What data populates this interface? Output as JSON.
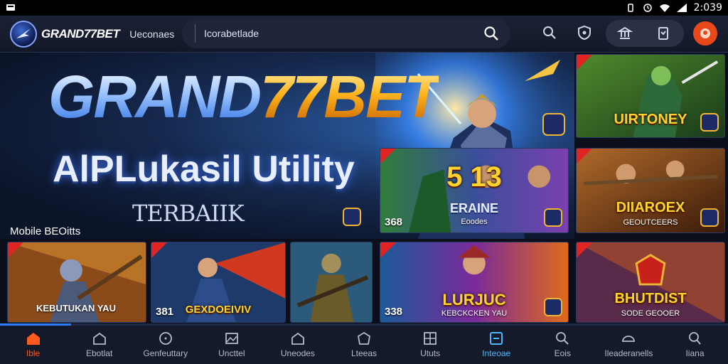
{
  "status_bar": {
    "time": "2:039"
  },
  "header": {
    "logo_text": "GRAND77BET",
    "nav_link": "Ueconaes",
    "search_text": "Icorabetlade"
  },
  "hero": {
    "brand_part_1": "GRAND",
    "brand_part_2": "77BET",
    "tagline": "AlPLukasil Utility",
    "subtagline": "TERBAIIK"
  },
  "section": {
    "label": "Mobile BEOitts"
  },
  "tiles": {
    "t1": {
      "title": "UIRTONEY"
    },
    "t2": {
      "title": "5 13",
      "subtitle": "ERAINE",
      "sub2": "Eoodes",
      "number": "368"
    },
    "t3": {
      "title": "DIIAROEX",
      "subtitle": "GEOUTCEERS"
    },
    "t4": {
      "caption": "KEBUTUKAN YAU"
    },
    "t5": {
      "title": "GEXDOEIVIV",
      "number": "381"
    },
    "t6": {},
    "t7": {
      "title": "LURJUC",
      "subtitle": "KEBCKCKEN YAU",
      "number": "338"
    },
    "t8": {
      "title": "BHUTDIST",
      "subtitle": "SODE GEOOER"
    }
  },
  "bottom_nav": [
    {
      "label": "Ible",
      "icon": "home-icon"
    },
    {
      "label": "Ebotlat",
      "icon": "home-outline-icon"
    },
    {
      "label": "Genfeuttary",
      "icon": "clock-icon"
    },
    {
      "label": "Uncttel",
      "icon": "image-icon"
    },
    {
      "label": "Uneodes",
      "icon": "house-icon"
    },
    {
      "label": "Lteeas",
      "icon": "store-icon"
    },
    {
      "label": "Ututs",
      "icon": "grid-icon"
    },
    {
      "label": "Inteoae",
      "icon": "square-icon"
    },
    {
      "label": "Eois",
      "icon": "search-icon"
    },
    {
      "label": "Ileaderanells",
      "icon": "chat-icon"
    },
    {
      "label": "Iiana",
      "icon": "magnify-icon"
    }
  ],
  "colors": {
    "accent_active": "#ff5a1f",
    "accent_selected": "#4db6ff",
    "avatar": "#e9491a",
    "gold": "#ffd22e"
  }
}
